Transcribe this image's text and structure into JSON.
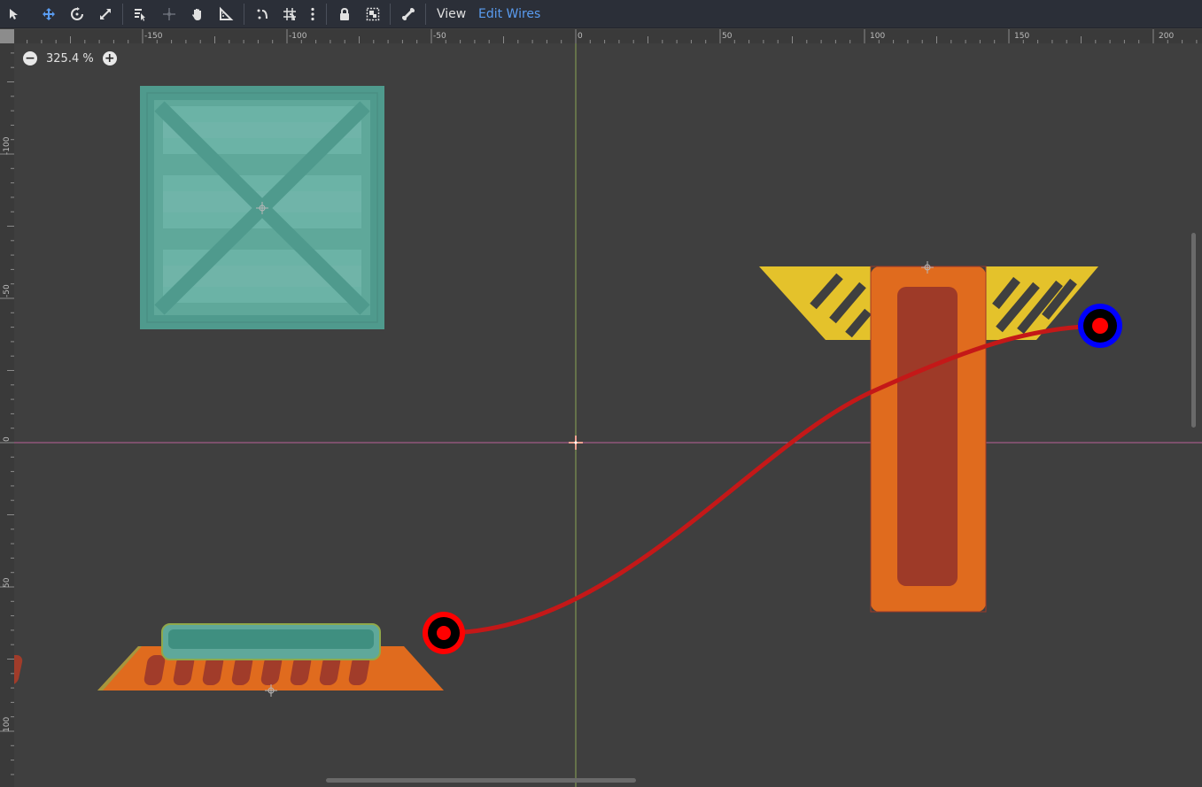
{
  "toolbar": {
    "tools": [
      {
        "id": "select",
        "icon": "select-arrow-icon"
      },
      {
        "id": "move",
        "icon": "move-icon"
      },
      {
        "id": "rotate",
        "icon": "rotate-icon"
      },
      {
        "id": "scale",
        "icon": "scale-icon"
      },
      {
        "id": "list-select",
        "icon": "list-select-icon"
      },
      {
        "id": "pivot",
        "icon": "pivot-icon"
      },
      {
        "id": "pan",
        "icon": "hand-icon"
      },
      {
        "id": "ruler",
        "icon": "ruler-icon"
      },
      {
        "id": "smart-snap",
        "icon": "snap-icon"
      },
      {
        "id": "grid-snap",
        "icon": "grid-snap-icon"
      },
      {
        "id": "snap-options",
        "icon": "vertical-dots-icon"
      },
      {
        "id": "lock",
        "icon": "lock-icon"
      },
      {
        "id": "group",
        "icon": "group-icon"
      },
      {
        "id": "bones",
        "icon": "bone-icon"
      }
    ],
    "view_label": "View",
    "edit_wires_label": "Edit Wires",
    "active_color": "#5a9cf0"
  },
  "zoom": {
    "label": "325.4 %"
  },
  "rulers": {
    "top": [
      {
        "value": "-150"
      },
      {
        "value": "-100"
      },
      {
        "value": "-50"
      },
      {
        "value": "0"
      },
      {
        "value": "50"
      },
      {
        "value": "100"
      },
      {
        "value": "150"
      },
      {
        "value": "200"
      }
    ],
    "left": [
      {
        "value": "-100"
      },
      {
        "value": "-50"
      },
      {
        "value": "0"
      },
      {
        "value": "50"
      },
      {
        "value": "100"
      }
    ]
  },
  "colors": {
    "canvas_bg": "#3f3f3f",
    "x_axis": "#b8609a",
    "y_axis": "#9fbf5a",
    "crate": "#5fa89a",
    "orange": "#e06b1e",
    "dark_red": "#9e3a28",
    "yellow": "#e4c22b",
    "wire": "#c41818",
    "node_red": "#ff0000",
    "node_blue": "#0000ff"
  }
}
